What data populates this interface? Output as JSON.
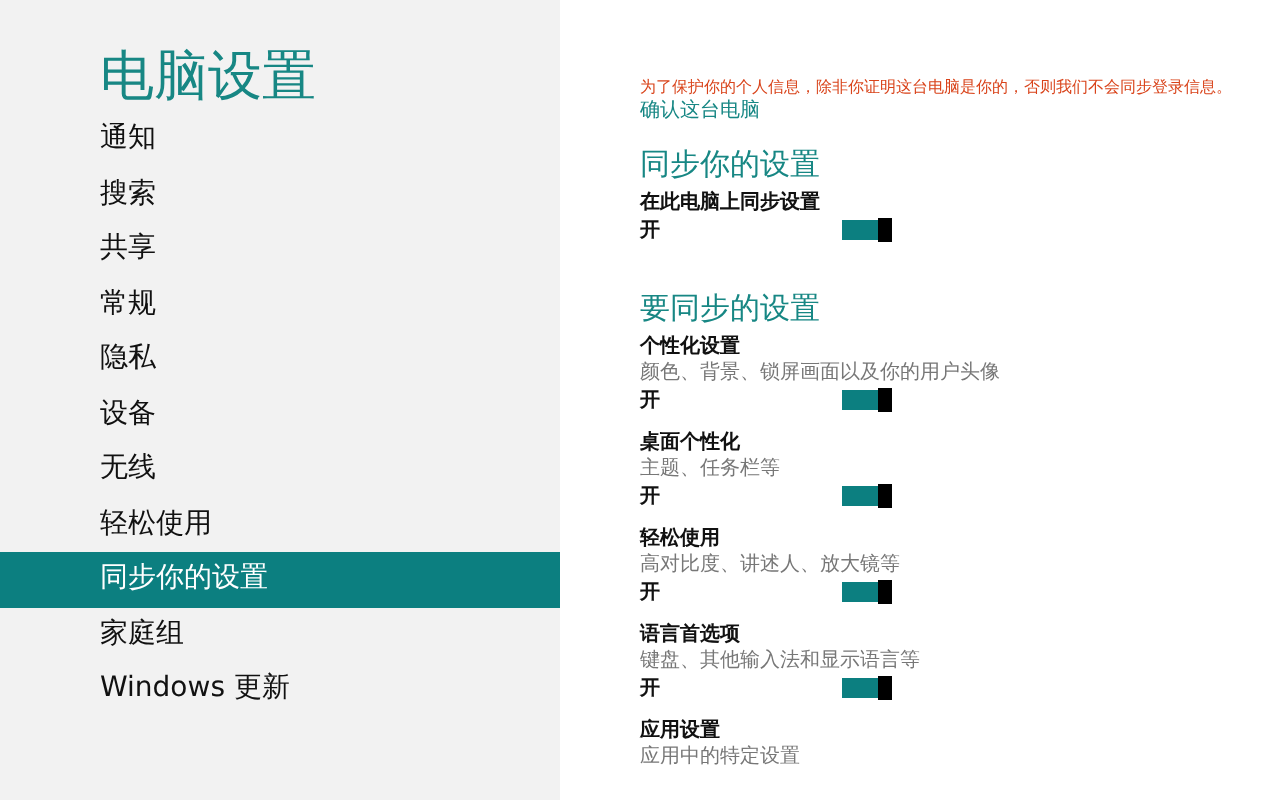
{
  "sidebar": {
    "title": "电脑设置",
    "items": [
      {
        "label": "通知",
        "selected": false
      },
      {
        "label": "搜索",
        "selected": false
      },
      {
        "label": "共享",
        "selected": false
      },
      {
        "label": "常规",
        "selected": false
      },
      {
        "label": "隐私",
        "selected": false
      },
      {
        "label": "设备",
        "selected": false
      },
      {
        "label": "无线",
        "selected": false
      },
      {
        "label": "轻松使用",
        "selected": false
      },
      {
        "label": "同步你的设置",
        "selected": true
      },
      {
        "label": "家庭组",
        "selected": false
      },
      {
        "label": "Windows 更新",
        "selected": false
      }
    ]
  },
  "content": {
    "warning": "为了保护你的个人信息，除非你证明这台电脑是你的，否则我们不会同步登录信息。",
    "link": "确认这台电脑",
    "sections": [
      {
        "heading": "同步你的设置",
        "settings": [
          {
            "title": "在此电脑上同步设置",
            "state_label": "开",
            "on": true
          }
        ]
      },
      {
        "heading": "要同步的设置",
        "settings": [
          {
            "title": "个性化设置",
            "description": "颜色、背景、锁屏画面以及你的用户头像",
            "state_label": "开",
            "on": true
          },
          {
            "title": "桌面个性化",
            "description": "主题、任务栏等",
            "state_label": "开",
            "on": true
          },
          {
            "title": "轻松使用",
            "description": "高对比度、讲述人、放大镜等",
            "state_label": "开",
            "on": true
          },
          {
            "title": "语言首选项",
            "description": "键盘、其他输入法和显示语言等",
            "state_label": "开",
            "on": true
          },
          {
            "title": "应用设置",
            "description": "应用中的特定设置"
          }
        ]
      }
    ]
  }
}
